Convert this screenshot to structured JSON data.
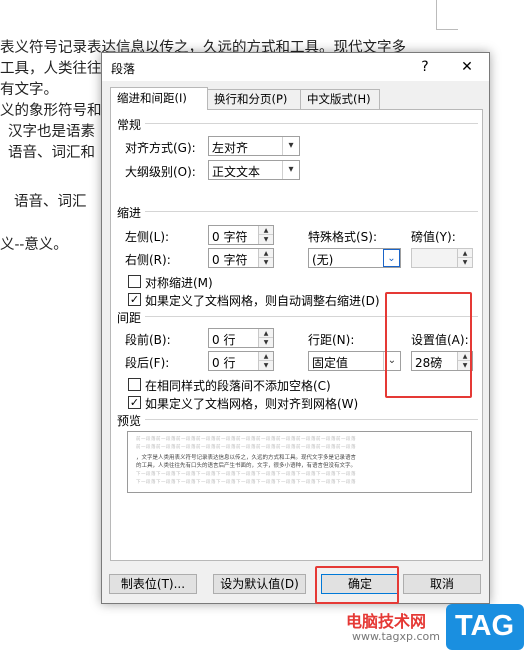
{
  "document": {
    "lines": [
      "表义符号记录表达信息以传之，久远的方式和工具。现代文字多",
      "工具，人类往往",
      "有文字。",
      "义的象形符号和",
      "汉字也是语素",
      "语音、词汇和",
      "语音、词汇",
      "义--意义。"
    ]
  },
  "dialog": {
    "title": "段落",
    "help": "?",
    "close": "✕",
    "tabs": [
      "缩进和间距(I)",
      "换行和分页(P)",
      "中文版式(H)"
    ],
    "general": {
      "heading": "常规",
      "alignment_label": "对齐方式(G):",
      "alignment_value": "左对齐",
      "outline_label": "大纲级别(O):",
      "outline_value": "正文文本"
    },
    "indent": {
      "heading": "缩进",
      "left_label": "左侧(L):",
      "left_value": "0 字符",
      "right_label": "右侧(R):",
      "right_value": "0 字符",
      "special_label": "特殊格式(S):",
      "special_value": "(无)",
      "by_label": "磅值(Y):",
      "by_value": "",
      "mirror_label": "对称缩进(M)",
      "mirror_checked": false,
      "auto_right_label": "如果定义了文档网格，则自动调整右缩进(D)",
      "auto_right_checked": true
    },
    "spacing": {
      "heading": "间距",
      "before_label": "段前(B):",
      "before_value": "0 行",
      "after_label": "段后(F):",
      "after_value": "0 行",
      "line_label": "行距(N):",
      "line_value": "固定值",
      "at_label": "设置值(A):",
      "at_value": "28磅",
      "no_space_label": "在相同样式的段落间不添加空格(C)",
      "no_space_checked": false,
      "snap_grid_label": "如果定义了文档网格，则对齐到网格(W)",
      "snap_grid_checked": true
    },
    "preview": {
      "heading": "预览",
      "prev_text": "前一段落前一段落前一段落前一段落前一段落前一段落前一段落前一段落前一段落前一段落前一段落",
      "main_text_1": "，文字是人类用表义符号记录表达信息以传之，久远的方式和工具。现代文字多是记录语言",
      "main_text_2": "的工具，人类往往先有口头的语言后产生书面的，文字，很多小语种，有语言但没有文字。",
      "next_text": "下一段落下一段落下一段落下一段落下一段落下一段落下一段落下一段落下一段落下一段落下一段落"
    },
    "buttons": {
      "tabs": "制表位(T)...",
      "set_default": "设为默认值(D)",
      "ok": "确定",
      "cancel": "取消"
    }
  },
  "watermark": {
    "site_name": "电脑技术网",
    "url": "www.tagxp.com",
    "tag": "TAG"
  },
  "colors": {
    "highlight": "#e53935",
    "tag_bg": "#1a8fe0",
    "watermark_text": "#e53935"
  }
}
